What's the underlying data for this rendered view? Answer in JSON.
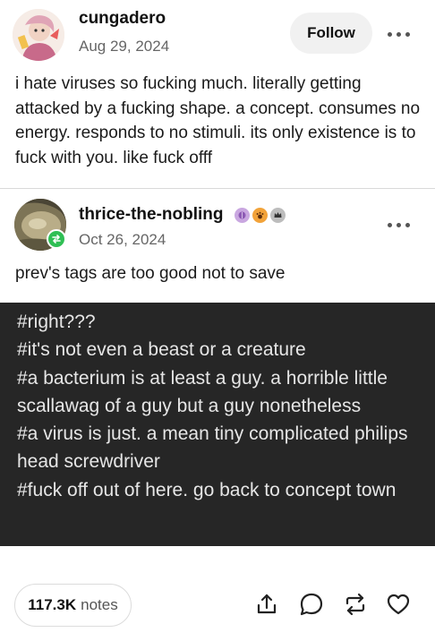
{
  "post1": {
    "username": "cungadero",
    "date": "Aug 29, 2024",
    "follow_label": "Follow",
    "body": "i hate viruses so fucking much. literally getting attacked by a fucking shape. a concept. consumes no energy. responds to no stimuli. its only existence is to fuck with you. like fuck offf"
  },
  "post2": {
    "username": "thrice-the-nobling",
    "date": "Oct 26, 2024",
    "body": "prev's tags are too good not to save",
    "badges": [
      "brain-badge-icon",
      "paw-badge-icon",
      "crown-badge-icon"
    ],
    "tags": [
      "#right???",
      "#it's not even a beast or a creature",
      "#a bacterium is at least a guy. a horrible little scallawag of a guy but a guy nonetheless",
      "#a virus is just. a mean tiny complicated philips head screwdriver",
      "#fuck off out of here. go back to concept town"
    ]
  },
  "footer": {
    "notes_count": "117.3K",
    "notes_label": "notes",
    "actions": [
      "share-icon",
      "reply-icon",
      "reblog-icon",
      "like-icon"
    ]
  },
  "colors": {
    "tags_background": "#262626",
    "tags_text": "#e6e6e6",
    "reblog_badge": "#2fbf54"
  }
}
